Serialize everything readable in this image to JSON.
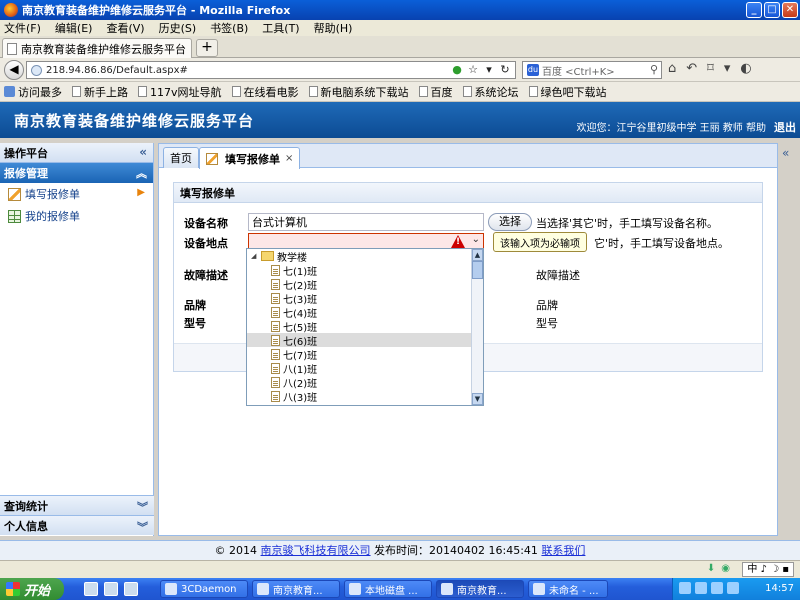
{
  "window": {
    "title": "南京教育装备维护维修云服务平台 - Mozilla Firefox",
    "minimize": "_",
    "maximize": "□",
    "close": "✕"
  },
  "menu": [
    "文件(F)",
    "编辑(E)",
    "查看(V)",
    "历史(S)",
    "书签(B)",
    "工具(T)",
    "帮助(H)"
  ],
  "browser_tab": {
    "label": "南京教育装备维护维修云服务平台",
    "new_tab": "+"
  },
  "nav": {
    "back": "◀",
    "url": "218.94.86.86/Default.aspx#",
    "search_placeholder": "百度 <Ctrl+K>"
  },
  "bookmarks": [
    "访问最多",
    "新手上路",
    "117v网址导航",
    "在线看电影",
    "新电脑系统下载站",
    "百度",
    "系统论坛",
    "绿色吧下载站"
  ],
  "app": {
    "title": "南京教育装备维护维修云服务平台",
    "welcome": "欢迎您：江宁谷里初级中学 王丽 教师 帮助",
    "logout": "退出"
  },
  "sidebar": {
    "header": "操作平台",
    "section": "报修管理",
    "items": [
      {
        "label": "填写报修单",
        "active": true
      },
      {
        "label": "我的报修单",
        "active": false
      }
    ],
    "bottom_sections": [
      "查询统计",
      "个人信息"
    ]
  },
  "main": {
    "tabs": [
      {
        "label": "首页"
      },
      {
        "label": "填写报修单",
        "close": "×"
      }
    ],
    "panel_title": "填写报修单",
    "form": {
      "device_name_label": "设备名称",
      "device_name_value": "台式计算机",
      "select_button": "选择",
      "device_name_hint": "当选择'其它'时，手工填写设备名称。",
      "device_location_label": "设备地点",
      "device_location_value": "",
      "device_location_hint": "它'时，手工填写设备地点。",
      "fault_label": "故障描述",
      "fault_side": "故障描述",
      "brand_label": "品牌",
      "brand_side": "品牌",
      "model_label": "型号",
      "model_side": "型号"
    },
    "tooltip": "该输入项为必输项",
    "tree": {
      "root": "教学楼",
      "items": [
        "七(1)班",
        "七(2)班",
        "七(3)班",
        "七(4)班",
        "七(5)班",
        "七(6)班",
        "七(7)班",
        "八(1)班",
        "八(2)班",
        "八(3)班"
      ],
      "selected_index": 5
    }
  },
  "footer": {
    "copyright": "© 2014 ",
    "company": "南京骏飞科技有限公司",
    "publish": " 发布时间：20140402 16:45:41 ",
    "contact": "联系我们"
  },
  "statusbar": {
    "ime": "中 ♪ ☽ ▪"
  },
  "taskbar": {
    "start": "开始",
    "tasks": [
      "3CDaemon",
      "南京教育...",
      "本地磁盘 ...",
      "南京教育...",
      "未命名 - ..."
    ],
    "active_index": 3,
    "clock": "14:57"
  }
}
